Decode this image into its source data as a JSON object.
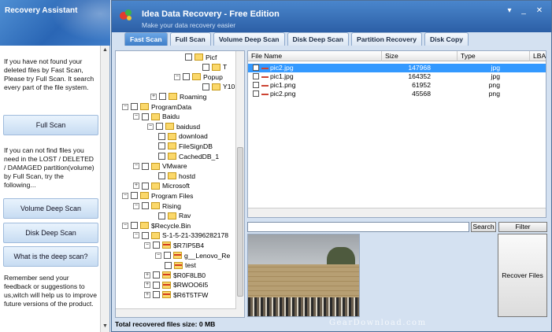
{
  "assistant": {
    "title": "Recovery Assistant",
    "text1": "If you have not found your deleted files by Fast Scan, Please try Full Scan. It search every part of the file system.",
    "full_scan_button": "Full Scan",
    "text2": "If you can not find files you need in the LOST / DELETED / DAMAGED partition(volume) by Full Scan, try the following...",
    "volume_deep_scan_button": "Volume Deep Scan",
    "disk_deep_scan_button": "Disk Deep Scan",
    "what_is_deep_scan_button": "What is the deep scan?",
    "text3": "Remember send your feedback or suggestions to us,witch will help us to improve future versions of the product."
  },
  "window": {
    "title": "Idea Data Recovery  - Free Edition",
    "subtitle": "Make your data recovery easier",
    "controls": {
      "menu": "▾",
      "minimize": "_",
      "close": "✕"
    }
  },
  "tabs": [
    {
      "label": "Fast Scan",
      "active": true
    },
    {
      "label": "Full Scan",
      "active": false
    },
    {
      "label": "Volume Deep Scan",
      "active": false
    },
    {
      "label": "Disk Deep Scan",
      "active": false
    },
    {
      "label": "Partition Recovery",
      "active": false
    },
    {
      "label": "Disk Copy",
      "active": false
    }
  ],
  "tree": [
    {
      "label": "Picf",
      "expander": "",
      "red": false
    },
    {
      "label": "T",
      "expander": "",
      "red": false
    },
    {
      "label": "Popup",
      "expander": "⊟",
      "red": false
    },
    {
      "label": "Y10",
      "expander": "",
      "red": false
    },
    {
      "label": "Roaming",
      "expander": "⊞",
      "red": false
    },
    {
      "label": "ProgramData",
      "expander": "⊟",
      "red": false
    },
    {
      "label": "Baidu",
      "expander": "⊟",
      "red": false
    },
    {
      "label": "baidusd",
      "expander": "⊟",
      "red": false
    },
    {
      "label": "download",
      "expander": "",
      "red": false
    },
    {
      "label": "FileSignDB",
      "expander": "",
      "red": false
    },
    {
      "label": "CachedDB_1",
      "expander": "",
      "red": false
    },
    {
      "label": "VMware",
      "expander": "⊟",
      "red": false
    },
    {
      "label": "hostd",
      "expander": "",
      "red": false
    },
    {
      "label": "Microsoft",
      "expander": "⊞",
      "red": false
    },
    {
      "label": "Program Files",
      "expander": "⊟",
      "red": false
    },
    {
      "label": "Rising",
      "expander": "⊟",
      "red": false
    },
    {
      "label": "Rav",
      "expander": "",
      "red": false
    },
    {
      "label": "$Recycle.Bin",
      "expander": "⊟",
      "red": false
    },
    {
      "label": "S-1-5-21-3396282178",
      "expander": "⊟",
      "red": false
    },
    {
      "label": "$R7IP5B4",
      "expander": "⊟",
      "red": true
    },
    {
      "label": "g__Lenovo_Re",
      "expander": "⊟",
      "red": true
    },
    {
      "label": "test",
      "expander": "",
      "red": true
    },
    {
      "label": "$R0F8LB0",
      "expander": "⊞",
      "red": true
    },
    {
      "label": "$RWOO6I5",
      "expander": "⊞",
      "red": true
    },
    {
      "label": "$R6T5TFW",
      "expander": "⊞",
      "red": true
    }
  ],
  "filelist": {
    "columns": [
      "File Name",
      "Size",
      "Type",
      "LBA"
    ],
    "rows": [
      {
        "name": "pic2.jpg",
        "size": "147968",
        "type": "jpg",
        "selected": true
      },
      {
        "name": "pic1.jpg",
        "size": "164352",
        "type": "jpg",
        "selected": false
      },
      {
        "name": "pic1.png",
        "size": "61952",
        "type": "png",
        "selected": false
      },
      {
        "name": "pic2.png",
        "size": "45568",
        "type": "png",
        "selected": false
      }
    ]
  },
  "search": {
    "value": "",
    "search_button": "Search",
    "filter_button": "Filter"
  },
  "recover_button": "Recover Files",
  "status": "Total recovered files size: 0 MB",
  "watermark": "GearDownload.com"
}
